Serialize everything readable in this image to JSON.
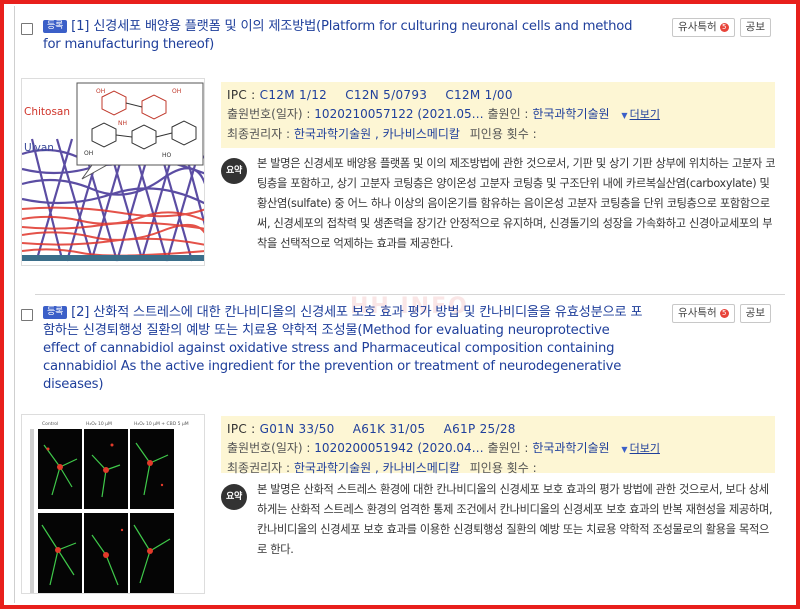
{
  "results": [
    {
      "status_badge": "등록",
      "title": "[1] 신경세포 배양용 플랫폼 및 이의 제조방법(Platform for culturing neuronal cells and method for manufacturing thereof)",
      "similar_btn": "유사특허",
      "gazette_btn": "공보",
      "ipc_label": "IPC :",
      "ipc_codes": [
        "C12M 1/12",
        "C12N 5/0793",
        "C12M 1/00"
      ],
      "app_label": "출원번호(일자) :",
      "app_value": "1020210057122 (2021.05…",
      "applicant_label": "출원인 :",
      "applicant_value": "한국과학기술원",
      "more": "더보기",
      "holder_label": "최종권리자 :",
      "holder_value": "한국과학기술원 , 카나비스메디칼",
      "cited_label": "피인용 횟수 :",
      "cited_value": "",
      "summary_pill": "요약",
      "abstract": "본 발명은 신경세포 배양용 플랫폼 및 이의 제조방법에 관한 것으로서, 기판 및 상기 기판 상부에 위치하는 고분자 코팅층을 포함하고, 상기 고분자 코팅층은 양이온성 고분자 코팅층 및 구조단위 내에 카르복실산염(carboxylate) 및 황산염(sulfate) 중 어느 하나 이상의 음이온기를 함유하는 음이온성 고분자 코팅층을 단위 코팅층으로 포함함으로써, 신경세포의 접착력 및 생존력을 장기간 안정적으로 유지하며, 신경돌기의 성장을 가속화하고 신경아교세포의 부착을 선택적으로 억제하는 효과를 제공한다.",
      "figure_labels": [
        "Chitosan",
        "Ulvan",
        "OH",
        "OH",
        "NH",
        "OH",
        "HO"
      ]
    },
    {
      "status_badge": "등록",
      "title": "[2] 산화적 스트레스에 대한 칸나비디올의 신경세포 보호 효과 평가 방법 및 칸나비디올을 유효성분으로 포함하는 신경퇴행성 질환의 예방 또는 치료용 약학적 조성물(Method for evaluating neuroprotective effect of cannabidiol against oxidative stress and Pharmaceutical composition containing cannabidiol As the active ingredient for the prevention or treatment of neurodegenerative diseases)",
      "similar_btn": "유사특허",
      "gazette_btn": "공보",
      "ipc_label": "IPC :",
      "ipc_codes": [
        "G01N 33/50",
        "A61K 31/05",
        "A61P 25/28"
      ],
      "app_label": "출원번호(일자) :",
      "app_value": "1020200051942 (2020.04…",
      "applicant_label": "출원인 :",
      "applicant_value": "한국과학기술원",
      "more": "더보기",
      "holder_label": "최종권리자 :",
      "holder_value": "한국과학기술원 , 카나비스메디칼",
      "cited_label": "피인용 횟수 :",
      "cited_value": "",
      "summary_pill": "요약",
      "abstract": "본 발명은 산화적 스트레스 환경에 대한 칸나비디올의 신경세포 보호 효과의 평가 방법에 관한 것으로서, 보다 상세하게는 산화적 스트레스 환경의 엄격한 통제 조건에서 칸나비디올의 신경세포 보호 효과의 반복 재현성을 제공하며, 칸나비디올의 신경세포 보호 효과를 이용한 신경퇴행성 질환의 예방 또는 치료용 약학적 조성물로의 활용을 목적으로 한다.",
      "figure_labels": [
        "Control",
        "H₂O₂ 10 μM",
        "H₂O₂ 10 μM + CBD 5 μM"
      ]
    }
  ],
  "watermark": "HH INFO",
  "colors": {
    "border_red": "#e8201c",
    "link_blue": "#1f3f9b",
    "info_bg": "#fdf6d4"
  }
}
